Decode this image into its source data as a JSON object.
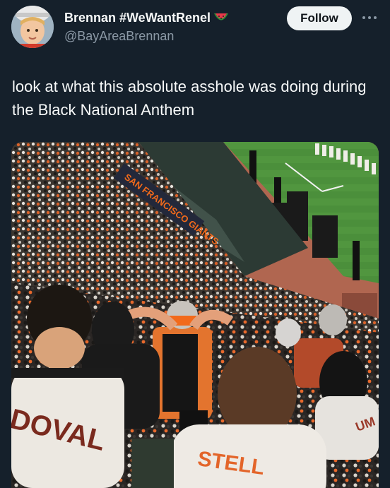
{
  "tweet": {
    "author": {
      "display_name": "Brennan #WeWantRenel",
      "handle": "@BayAreaBrennan",
      "avatar_icon": "child-photo-avatar",
      "name_emoji_icon": "watermelon-icon"
    },
    "follow_label": "Follow",
    "more_icon": "more-options-icon",
    "text": "look at what this absolute asshole was doing during the Black National Anthem",
    "media": {
      "banner_text": "SAN FRANCISCO GIANTS",
      "jersey_left_text": "DOVAL",
      "jersey_center_text": "STELL",
      "jersey_right_text": "UM"
    }
  },
  "colors": {
    "background": "#15202b",
    "text_primary": "#f7f9f9",
    "text_secondary": "#8b98a5",
    "follow_bg": "#eff3f4",
    "giants_orange": "#f26a1b",
    "field_green": "#4a8f3a",
    "warning_track": "#b86a4e"
  }
}
